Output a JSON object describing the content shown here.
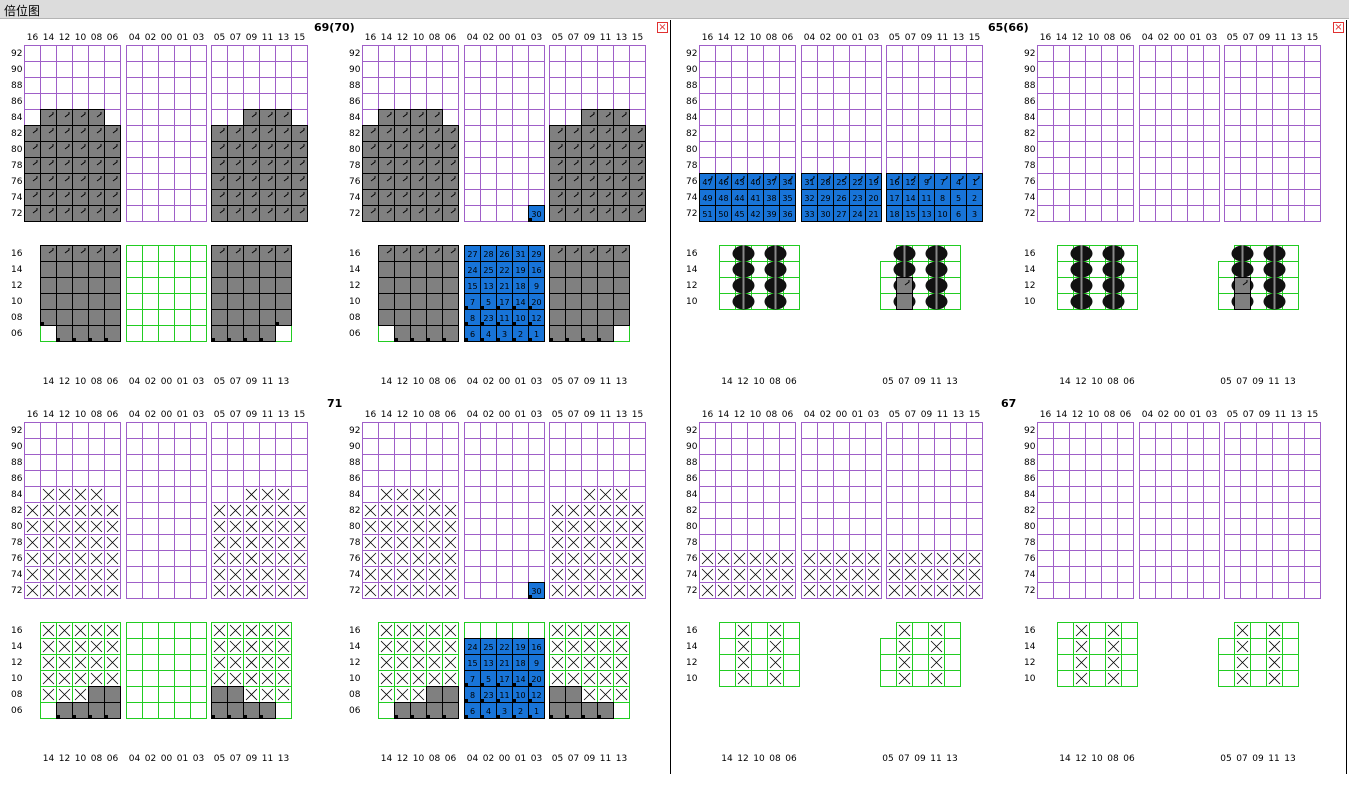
{
  "window": {
    "title": "倍位图",
    "close_icon": "close-icon"
  },
  "bays": [
    {
      "label": "69(70)",
      "pos": "top-left"
    },
    {
      "label": "65(66)",
      "pos": "top-right"
    },
    {
      "label": "71",
      "pos": "bottom-left"
    },
    {
      "label": "67",
      "pos": "bottom-right"
    }
  ],
  "deck_row_labels": [
    "16",
    "14",
    "12",
    "10",
    "08",
    "06",
    "04",
    "02",
    "00",
    "01",
    "03",
    "05",
    "07",
    "09",
    "11",
    "13",
    "15"
  ],
  "deck_tier_labels": [
    "92",
    "90",
    "88",
    "86",
    "84",
    "82",
    "80",
    "78",
    "76",
    "74",
    "72"
  ],
  "hold_row_labels_wide": [
    "14",
    "12",
    "10",
    "08",
    "06",
    "04",
    "02",
    "00",
    "01",
    "03",
    "05",
    "07",
    "09",
    "11",
    "13"
  ],
  "hold_row_labels_narrow": [
    "14",
    "12",
    "10",
    "08",
    "06",
    "05",
    "07",
    "09",
    "11",
    "13"
  ],
  "hold_tier_labels_wide": [
    "16",
    "14",
    "12",
    "10",
    "08",
    "06"
  ],
  "hold_tier_labels_narrow": [
    "16",
    "14",
    "12",
    "10"
  ],
  "colors": {
    "deck_grid": "#9f5fc8",
    "hold_grid": "#22cc22",
    "occupied": "#808080",
    "planned": "#1874d8",
    "divider": "#000000",
    "close": "#e03030"
  },
  "slot_numbers": {
    "p69_deck": [
      "47",
      "46",
      "43",
      "40",
      "37",
      "34",
      "31",
      "28",
      "25",
      "22",
      "19",
      "16",
      "12",
      "9",
      "7",
      "4",
      "1",
      "49",
      "48",
      "44",
      "41",
      "38",
      "35",
      "32",
      "29",
      "26",
      "23",
      "20",
      "17",
      "14",
      "11",
      "8",
      "5",
      "2",
      "51",
      "50",
      "45",
      "42",
      "39",
      "36",
      "33",
      "30",
      "27",
      "24",
      "21",
      "18",
      "15",
      "13",
      "10",
      "6",
      "3"
    ],
    "p69_deck_single": "30",
    "p69_hold": [
      "27",
      "28",
      "26",
      "31",
      "29",
      "24",
      "25",
      "22",
      "19",
      "16",
      "15",
      "13",
      "21",
      "18",
      "9",
      "7",
      "5",
      "17",
      "14",
      "20",
      "8",
      "23",
      "11",
      "10",
      "12",
      "6",
      "4",
      "3",
      "2",
      "1"
    ],
    "p71_hold": [
      "24",
      "25",
      "22",
      "19",
      "16",
      "15",
      "13",
      "21",
      "18",
      "9",
      "7",
      "5",
      "17",
      "14",
      "20",
      "8",
      "23",
      "11",
      "10",
      "12",
      "6",
      "4",
      "3",
      "2",
      "1"
    ],
    "p71_deck_single": "30"
  }
}
